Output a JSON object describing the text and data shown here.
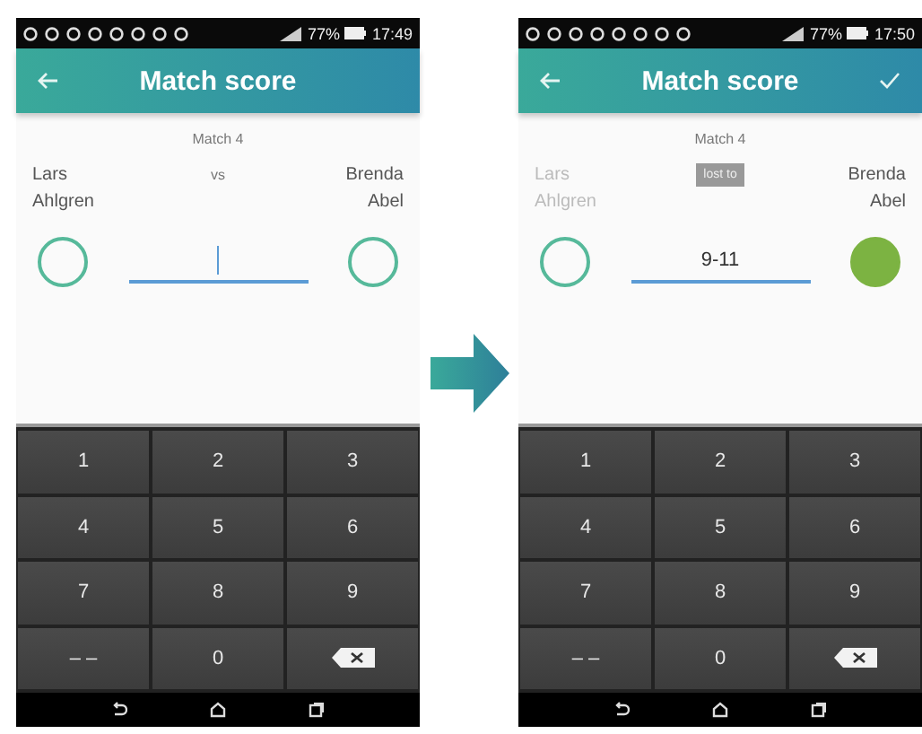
{
  "screens": [
    {
      "status": {
        "battery": "77%",
        "time": "17:49"
      },
      "title": "Match score",
      "confirm_visible": false,
      "match_label": "Match 4",
      "result": {
        "kind": "plain",
        "text": "vs"
      },
      "players": [
        {
          "first": "Lars",
          "last": "Ahlgren",
          "dimmed": false,
          "won": false
        },
        {
          "first": "Brenda",
          "last": "Abel",
          "dimmed": false,
          "won": false
        }
      ],
      "score": {
        "focused": true
      },
      "keys": [
        {
          "kind": "text",
          "label": "1"
        },
        {
          "kind": "text",
          "label": "2"
        },
        {
          "kind": "text",
          "label": "3"
        },
        {
          "kind": "text",
          "label": "4"
        },
        {
          "kind": "text",
          "label": "5"
        },
        {
          "kind": "text",
          "label": "6"
        },
        {
          "kind": "text",
          "label": "7"
        },
        {
          "kind": "text",
          "label": "8"
        },
        {
          "kind": "text",
          "label": "9"
        },
        {
          "kind": "text",
          "label": "– –"
        },
        {
          "kind": "text",
          "label": "0"
        },
        {
          "kind": "backspace"
        }
      ]
    },
    {
      "status": {
        "battery": "77%",
        "time": "17:50"
      },
      "title": "Match score",
      "confirm_visible": true,
      "match_label": "Match 4",
      "result": {
        "kind": "badge",
        "text": "lost to"
      },
      "players": [
        {
          "first": "Lars",
          "last": "Ahlgren",
          "dimmed": true,
          "won": false
        },
        {
          "first": "Brenda",
          "last": "Abel",
          "dimmed": false,
          "won": true
        }
      ],
      "score": {
        "value": "9-11",
        "focused": false
      },
      "keys": [
        {
          "kind": "text",
          "label": "1"
        },
        {
          "kind": "text",
          "label": "2"
        },
        {
          "kind": "text",
          "label": "3"
        },
        {
          "kind": "text",
          "label": "4"
        },
        {
          "kind": "text",
          "label": "5"
        },
        {
          "kind": "text",
          "label": "6"
        },
        {
          "kind": "text",
          "label": "7"
        },
        {
          "kind": "text",
          "label": "8"
        },
        {
          "kind": "text",
          "label": "9"
        },
        {
          "kind": "text",
          "label": "– –"
        },
        {
          "kind": "text",
          "label": "0"
        },
        {
          "kind": "backspace"
        }
      ]
    }
  ]
}
